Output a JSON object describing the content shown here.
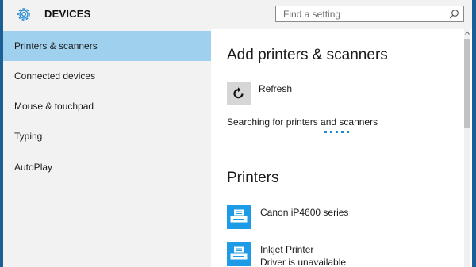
{
  "header": {
    "title": "DEVICES",
    "search_placeholder": "Find a setting",
    "gear_icon": "gear-icon",
    "search_icon": "search-icon"
  },
  "sidebar": {
    "items": [
      {
        "label": "Printers & scanners",
        "active": true
      },
      {
        "label": "Connected devices",
        "active": false
      },
      {
        "label": "Mouse & touchpad",
        "active": false
      },
      {
        "label": "Typing",
        "active": false
      },
      {
        "label": "AutoPlay",
        "active": false
      }
    ]
  },
  "main": {
    "add_heading": "Add printers & scanners",
    "refresh_label": "Refresh",
    "searching_text": "Searching for printers and scanners",
    "printers_heading": "Printers",
    "printers": [
      {
        "name": "Canon iP4600 series",
        "status": ""
      },
      {
        "name": "Inkjet Printer",
        "status": "Driver is unavailable"
      }
    ]
  },
  "colors": {
    "accent": "#1e9be6",
    "selected_item": "#9fd0ee",
    "desktop_background": "#1c5f95"
  }
}
